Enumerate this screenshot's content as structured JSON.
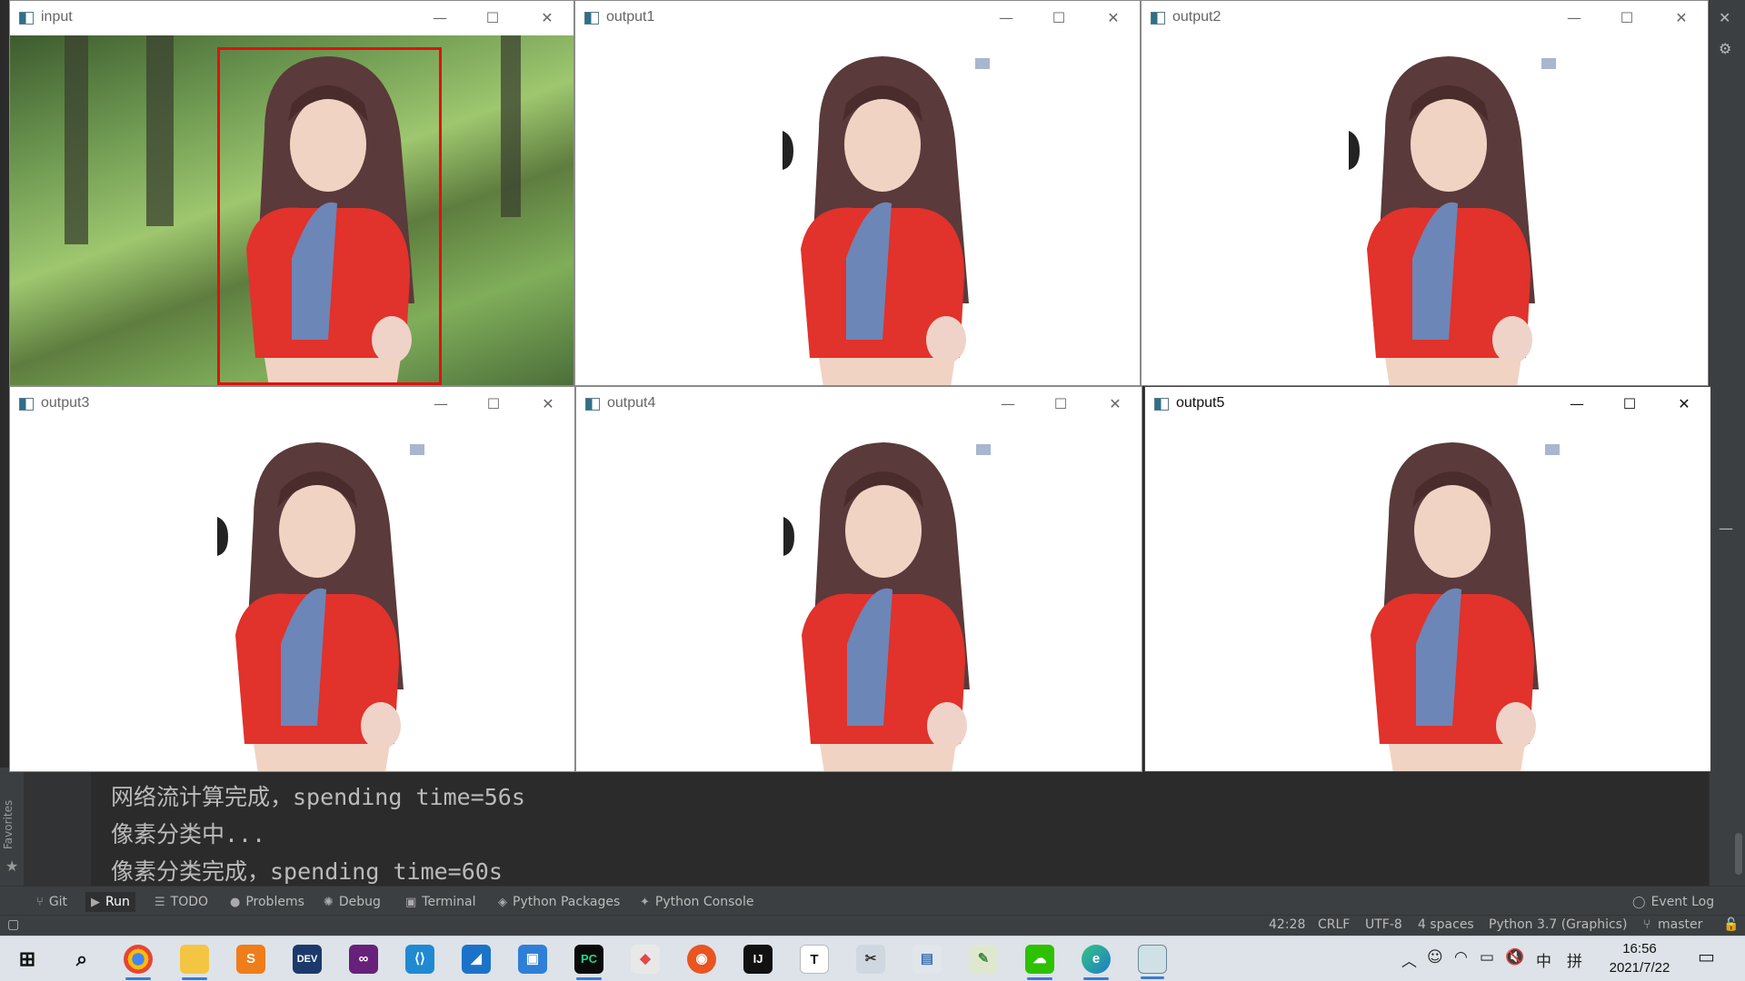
{
  "windows": [
    {
      "id": "input",
      "title": "input"
    },
    {
      "id": "output1",
      "title": "output1"
    },
    {
      "id": "output2",
      "title": "output2"
    },
    {
      "id": "output3",
      "title": "output3"
    },
    {
      "id": "output4",
      "title": "output4"
    },
    {
      "id": "output5",
      "title": "output5"
    }
  ],
  "window_buttons": {
    "minimize": "—",
    "maximize": "☐",
    "close": "✕"
  },
  "console": {
    "lines": [
      "网络流计算完成，spending time=56s",
      "像素分类中...",
      "像素分类完成，spending time=60s"
    ]
  },
  "side": {
    "favorites": "Favorites"
  },
  "toolwindows": [
    {
      "icon": "git-icon",
      "label": "Git"
    },
    {
      "icon": "run-icon",
      "label": "Run"
    },
    {
      "icon": "todo-icon",
      "label": "TODO"
    },
    {
      "icon": "problems-icon",
      "label": "Problems"
    },
    {
      "icon": "debug-icon",
      "label": "Debug"
    },
    {
      "icon": "terminal-icon",
      "label": "Terminal"
    },
    {
      "icon": "python-packages-icon",
      "label": "Python Packages"
    },
    {
      "icon": "python-console-icon",
      "label": "Python Console"
    }
  ],
  "event_log": "Event Log",
  "status": {
    "position": "42:28",
    "line_ending": "CRLF",
    "encoding": "UTF-8",
    "indent": "4 spaces",
    "interpreter": "Python 3.7 (Graphics)",
    "branch": "master"
  },
  "taskbar": {
    "apps": [
      "start",
      "search",
      "chrome",
      "file-explorer",
      "sublime-text",
      "dev-cpp",
      "visual-studio",
      "vscode",
      "xcode-like",
      "virtualbox",
      "pycharm",
      "git-kraken",
      "ubuntu",
      "intellij",
      "typora",
      "snipping",
      "photos",
      "paint",
      "wechat",
      "edge",
      "image-window"
    ],
    "ime_lang": "中",
    "ime_mode": "拼",
    "time": "16:56",
    "date": "2021/7/22"
  },
  "colors": {
    "bbox": "#e01010",
    "ide_bg": "#2b2b2b",
    "taskbar": "#dde3e8"
  }
}
